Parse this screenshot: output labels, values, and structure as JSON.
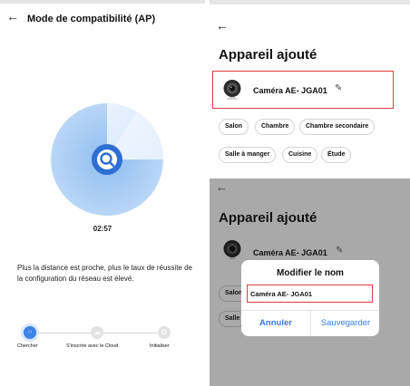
{
  "left_screen": {
    "back_icon": "←",
    "title": "Mode de compatibilité (AP)",
    "scan_icon": "search-icon",
    "timer": "02:57",
    "tip": "Plus la distance est proche, plus le taux de réussite de la configuration du réseau est élevé.",
    "steps": [
      {
        "label": "Chercher",
        "state": "active"
      },
      {
        "label": "S'inscrire avec le Cloud",
        "state": "inactive"
      },
      {
        "label": "Initialiser",
        "state": "inactive"
      }
    ]
  },
  "device_added_screen": {
    "back_icon": "←",
    "heading": "Appareil ajouté",
    "device_name": "Caméra AE- JGA01",
    "edit_icon": "✎",
    "rooms": [
      "Salon",
      "Chambre",
      "Chambre secondaire",
      "Salle à manger",
      "Cuisine",
      "Étude"
    ]
  },
  "rename_screen": {
    "back_icon": "←",
    "heading": "Appareil ajouté",
    "device_name": "Caméra AE- JGA01",
    "edit_icon": "✎",
    "rooms_visible": [
      "Salon",
      "Salle"
    ],
    "dialog": {
      "title": "Modifier le nom",
      "input_value": "Caméra AE- JGA01",
      "cancel_label": "Annuler",
      "save_label": "Sauvegarder"
    }
  },
  "colors": {
    "accent_blue": "#3b82e6",
    "highlight_red": "#d93c3c",
    "overlay_gray": "#a9a9a9"
  }
}
